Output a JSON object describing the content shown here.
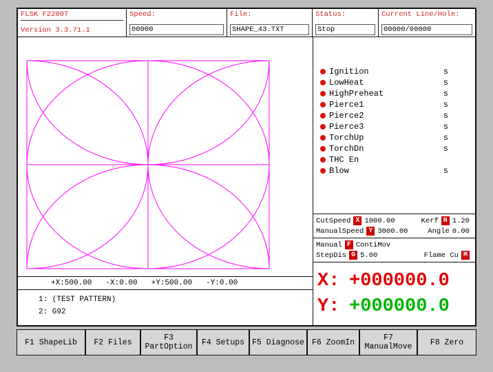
{
  "header": {
    "brand": "FLSK F2200T",
    "version": "Version 3.3.71.1",
    "speed_label": "Speed:",
    "speed_value": "00000",
    "file_label": "File:",
    "file_value": "SHAPE_43.TXT",
    "status_label": "Status:",
    "status_value": "Stop",
    "line_label": "Current Line/Hole:",
    "line_value": "00000/00000"
  },
  "status_panel": {
    "items": [
      {
        "label": "Ignition",
        "unit": "s"
      },
      {
        "label": "LowHeat",
        "unit": "s"
      },
      {
        "label": "HighPreheat",
        "unit": "s"
      },
      {
        "label": "Pierce1",
        "unit": "s"
      },
      {
        "label": "Pierce2",
        "unit": "s"
      },
      {
        "label": "Pierce3",
        "unit": "s"
      },
      {
        "label": "TorchUp",
        "unit": "s"
      },
      {
        "label": "TorchDn",
        "unit": "s"
      },
      {
        "label": "THC En",
        "unit": ""
      },
      {
        "label": "Blow",
        "unit": "s"
      }
    ]
  },
  "params": {
    "cutspeed_label": "CutSpeed",
    "cutspeed_key": "X",
    "cutspeed_value": "1000.00",
    "kerf_label": "Kerf",
    "kerf_key": "N",
    "kerf_value": "1.20",
    "manualspeed_label": "ManualSpeed",
    "manualspeed_key": "Y",
    "manualspeed_value": "3000.00",
    "angle_label": "Angle",
    "angle_value": "0.00",
    "manual_label": "Manual",
    "manual_key": "F",
    "manual_value": "ContiMov",
    "stepdis_label": "StepDis",
    "stepdis_key": "G",
    "stepdis_value": "5.00",
    "flame_label": "Flame Cu",
    "flame_key": "M"
  },
  "coords": {
    "x_label": "X:",
    "x_value": "+000000.0",
    "y_label": "Y:",
    "y_value": "+000000.0"
  },
  "limits": [
    "+X:500.00",
    "-X:0.00",
    "+Y:500.00",
    "-Y:0.00"
  ],
  "program_lines": [
    "1: (TEST PATTERN)",
    "2: G92"
  ],
  "function_keys": [
    {
      "line1": "F1 ShapeLib",
      "line2": ""
    },
    {
      "line1": "F2 Files",
      "line2": ""
    },
    {
      "line1": "F3",
      "line2": "PartOption"
    },
    {
      "line1": "F4 Setups",
      "line2": ""
    },
    {
      "line1": "F5 Diagnose",
      "line2": ""
    },
    {
      "line1": "F6 ZoomIn",
      "line2": ""
    },
    {
      "line1": "F7",
      "line2": "ManualMove"
    },
    {
      "line1": "F8 Zero",
      "line2": ""
    }
  ],
  "colors": {
    "header_red": "#cc2222",
    "dot_red": "#dd1111",
    "key_block_red": "#cc0000",
    "pattern_magenta": "#ff00ff",
    "x_red": "#e00000",
    "y_green": "#00b400"
  }
}
